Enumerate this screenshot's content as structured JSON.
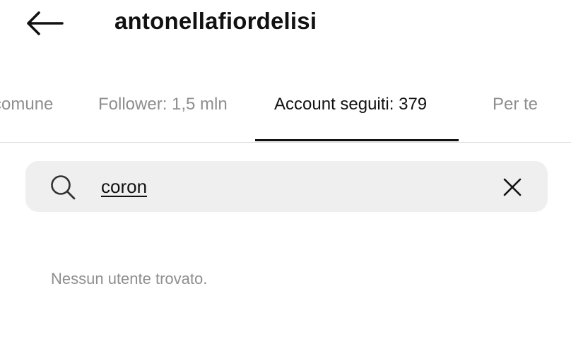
{
  "header": {
    "back_icon": "arrow-left-icon",
    "title": "antonellafiordelisi"
  },
  "tabs": [
    {
      "label": "comune",
      "active": false
    },
    {
      "label": "Follower: 1,5 mln",
      "active": false
    },
    {
      "label": "Account seguiti: 379",
      "active": true
    },
    {
      "label": "Per te",
      "active": false
    }
  ],
  "search": {
    "icon": "search-icon",
    "value": "coron",
    "clear_icon": "close-icon"
  },
  "results": {
    "empty_message": "Nessun utente trovato."
  },
  "colors": {
    "text_primary": "#111111",
    "text_secondary": "#8e8e8e",
    "search_bg": "#efefef",
    "divider": "#dbdbdb"
  }
}
